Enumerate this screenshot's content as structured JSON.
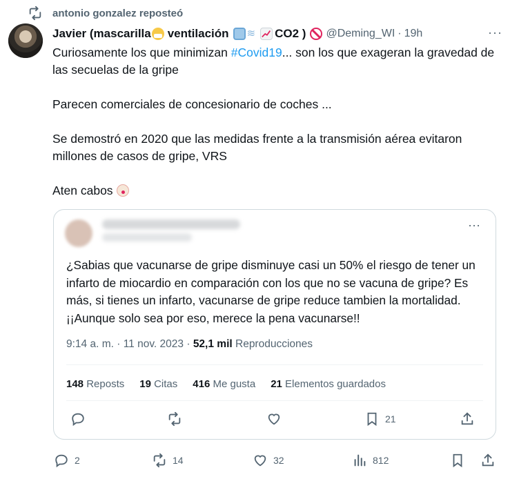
{
  "repost": {
    "label": "antonio gonzalez reposteó"
  },
  "tweet": {
    "author_name": "Javier (mascarilla",
    "author_name_ventilacion": "ventilación",
    "author_name_co2": "CO2 )",
    "handle": "@Deming_WI",
    "separator": "·",
    "time": "19h",
    "more": "···",
    "lines": [
      "Curiosamente los que minimizan",
      "Parecen comerciales de concesionario de coches ...",
      "Se demostró en 2020 que las medidas frente a la transmisión aérea evitaron millones de casos de gripe, VRS",
      "Aten cabos"
    ],
    "hashtag": "#Covid19",
    "line1_rest": "... son los que exageran la gravedad de las secuelas de la gripe"
  },
  "quote": {
    "more": "···",
    "text": "¿Sabias que vacunarse de gripe disminuye casi un 50% el riesgo de tener un infarto de miocardio en comparación con los que no se vacuna de gripe? Es más, si tienes un infarto, vacunarse de gripe reduce tambien la mortalidad. ¡¡Aunque solo sea por eso, merece la pena vacunarse!!",
    "time_date": "9:14 a. m. · 11 nov. 2023 ·",
    "views_value": "52,1 mil",
    "views_label": "Reproducciones",
    "stats": {
      "reposts_value": "148",
      "reposts_label": "Reposts",
      "citas_value": "19",
      "citas_label": "Citas",
      "likes_value": "416",
      "likes_label": "Me gusta",
      "saved_value": "21",
      "saved_label": "Elementos guardados"
    },
    "actions": {
      "bookmark_count": "21"
    }
  },
  "actions": {
    "replies": "2",
    "reposts": "14",
    "likes": "32",
    "views": "812"
  },
  "colors": {
    "link": "#1d9bf0",
    "muted": "#536471",
    "border": "#cfd9de",
    "text": "#0f1419"
  }
}
